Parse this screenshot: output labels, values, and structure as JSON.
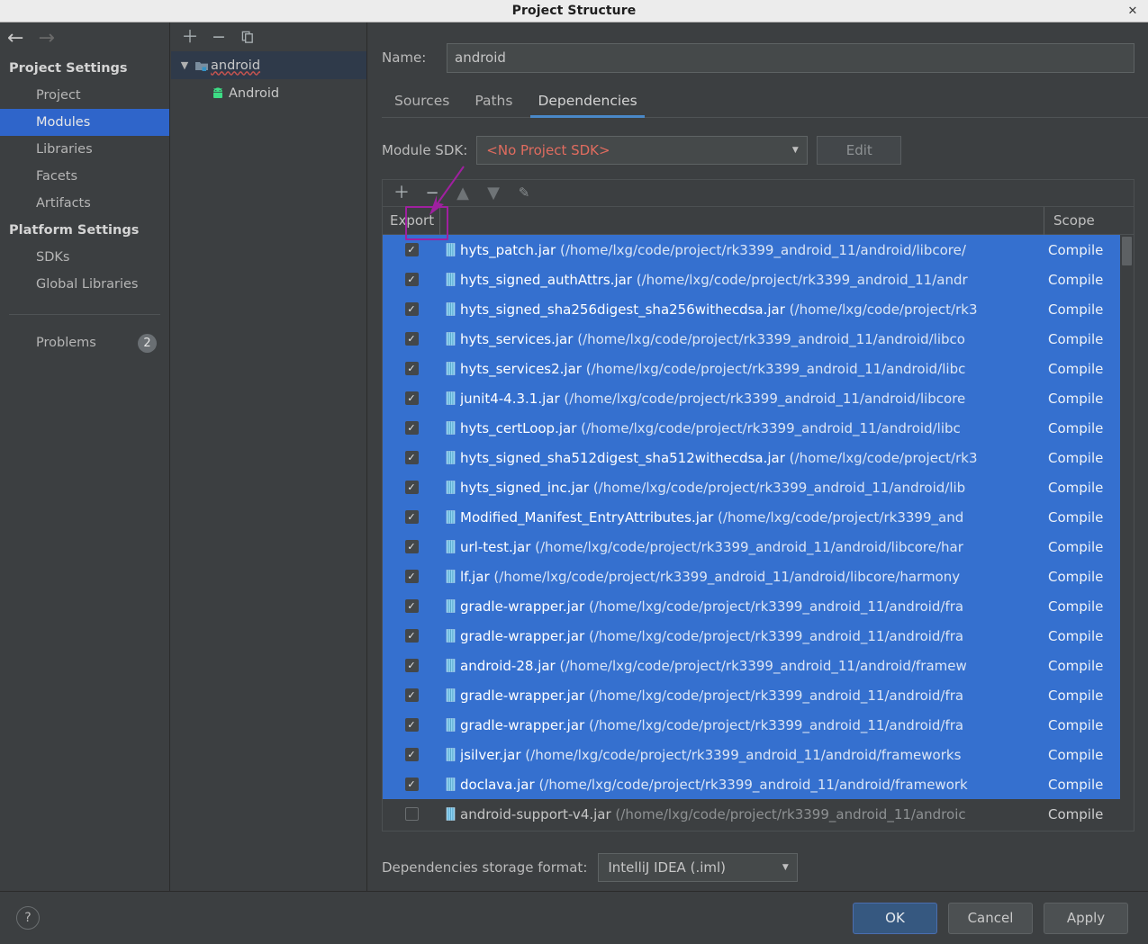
{
  "window": {
    "title": "Project Structure",
    "close_icon": "close-icon"
  },
  "sidebar": {
    "nav_back_icon": "arrow-left-icon",
    "nav_forward_icon": "arrow-right-icon",
    "groups": [
      {
        "title": "Project Settings",
        "items": [
          "Project",
          "Modules",
          "Libraries",
          "Facets",
          "Artifacts"
        ]
      },
      {
        "title": "Platform Settings",
        "items": [
          "SDKs",
          "Global Libraries"
        ]
      }
    ],
    "selected_item": "Modules",
    "problems": {
      "label": "Problems",
      "count": "2"
    }
  },
  "tree": {
    "toolbar": [
      "add-icon",
      "remove-icon",
      "copy-icon"
    ],
    "root": {
      "label": "android",
      "expanded_chevron": "∨",
      "icon": "module-folder-icon",
      "misspelled": true
    },
    "children": [
      {
        "label": "Android",
        "icon": "android-robot-icon"
      }
    ]
  },
  "form": {
    "name_label": "Name:",
    "name_value": "android",
    "name_placeholder": "",
    "tabs": [
      {
        "label": "Sources",
        "active": false
      },
      {
        "label": "Paths",
        "active": false
      },
      {
        "label": "Dependencies",
        "active": true
      }
    ],
    "module_sdk_label": "Module SDK:",
    "module_sdk_value": "<No Project SDK>",
    "edit_button": "Edit",
    "storage_label": "Dependencies storage format:",
    "storage_value": "IntelliJ IDEA (.iml)"
  },
  "deps_toolbar": [
    {
      "icon": "add-icon",
      "glyph": "＋",
      "dim": false
    },
    {
      "icon": "remove-icon",
      "glyph": "−",
      "dim": false
    },
    {
      "icon": "move-up-icon",
      "glyph": "▲",
      "dim": true
    },
    {
      "icon": "move-down-icon",
      "glyph": "▼",
      "dim": true
    },
    {
      "icon": "edit-pencil-icon",
      "glyph": "✎",
      "dim": true
    }
  ],
  "table": {
    "columns": {
      "export": "Export",
      "name": "",
      "scope": "Scope"
    },
    "scope_value": "Compile",
    "rows": [
      {
        "checked": true,
        "selected": true,
        "name": "hyts_patch.jar",
        "path": " (/home/lxg/code/project/rk3399_android_11/android/libcore/",
        "scope": "Compile"
      },
      {
        "checked": true,
        "selected": true,
        "name": "hyts_signed_authAttrs.jar",
        "path": " (/home/lxg/code/project/rk3399_android_11/andr",
        "scope": "Compile"
      },
      {
        "checked": true,
        "selected": true,
        "name": "hyts_signed_sha256digest_sha256withecdsa.jar",
        "path": " (/home/lxg/code/project/rk3",
        "scope": "Compile"
      },
      {
        "checked": true,
        "selected": true,
        "name": "hyts_services.jar",
        "path": " (/home/lxg/code/project/rk3399_android_11/android/libco",
        "scope": "Compile"
      },
      {
        "checked": true,
        "selected": true,
        "name": "hyts_services2.jar",
        "path": " (/home/lxg/code/project/rk3399_android_11/android/libc",
        "scope": "Compile"
      },
      {
        "checked": true,
        "selected": true,
        "name": "junit4-4.3.1.jar",
        "path": " (/home/lxg/code/project/rk3399_android_11/android/libcore",
        "scope": "Compile"
      },
      {
        "checked": true,
        "selected": true,
        "name": "hyts_certLoop.jar",
        "path": " (/home/lxg/code/project/rk3399_android_11/android/libc",
        "scope": "Compile"
      },
      {
        "checked": true,
        "selected": true,
        "name": "hyts_signed_sha512digest_sha512withecdsa.jar",
        "path": " (/home/lxg/code/project/rk3",
        "scope": "Compile"
      },
      {
        "checked": true,
        "selected": true,
        "name": "hyts_signed_inc.jar",
        "path": " (/home/lxg/code/project/rk3399_android_11/android/lib",
        "scope": "Compile"
      },
      {
        "checked": true,
        "selected": true,
        "name": "Modified_Manifest_EntryAttributes.jar",
        "path": " (/home/lxg/code/project/rk3399_and",
        "scope": "Compile"
      },
      {
        "checked": true,
        "selected": true,
        "name": "url-test.jar",
        "path": " (/home/lxg/code/project/rk3399_android_11/android/libcore/har",
        "scope": "Compile"
      },
      {
        "checked": true,
        "selected": true,
        "name": "lf.jar",
        "path": " (/home/lxg/code/project/rk3399_android_11/android/libcore/harmony",
        "scope": "Compile"
      },
      {
        "checked": true,
        "selected": true,
        "name": "gradle-wrapper.jar",
        "path": " (/home/lxg/code/project/rk3399_android_11/android/fra",
        "scope": "Compile"
      },
      {
        "checked": true,
        "selected": true,
        "name": "gradle-wrapper.jar",
        "path": " (/home/lxg/code/project/rk3399_android_11/android/fra",
        "scope": "Compile"
      },
      {
        "checked": true,
        "selected": true,
        "name": "android-28.jar",
        "path": " (/home/lxg/code/project/rk3399_android_11/android/framew",
        "scope": "Compile"
      },
      {
        "checked": true,
        "selected": true,
        "name": "gradle-wrapper.jar",
        "path": " (/home/lxg/code/project/rk3399_android_11/android/fra",
        "scope": "Compile"
      },
      {
        "checked": true,
        "selected": true,
        "name": "gradle-wrapper.jar",
        "path": " (/home/lxg/code/project/rk3399_android_11/android/fra",
        "scope": "Compile"
      },
      {
        "checked": true,
        "selected": true,
        "name": "jsilver.jar",
        "path": " (/home/lxg/code/project/rk3399_android_11/android/frameworks",
        "scope": "Compile"
      },
      {
        "checked": true,
        "selected": true,
        "name": "doclava.jar",
        "path": " (/home/lxg/code/project/rk3399_android_11/android/framework",
        "scope": "Compile"
      },
      {
        "checked": false,
        "selected": false,
        "name": "android-support-v4.jar",
        "path": " (/home/lxg/code/project/rk3399_android_11/androic",
        "scope": "Compile"
      }
    ]
  },
  "footer": {
    "help_icon": "question-mark-icon",
    "ok": "OK",
    "cancel": "Cancel",
    "apply": "Apply"
  },
  "annotation": {
    "highlight_color": "#a020a0",
    "target": "remove-dependency-button"
  }
}
